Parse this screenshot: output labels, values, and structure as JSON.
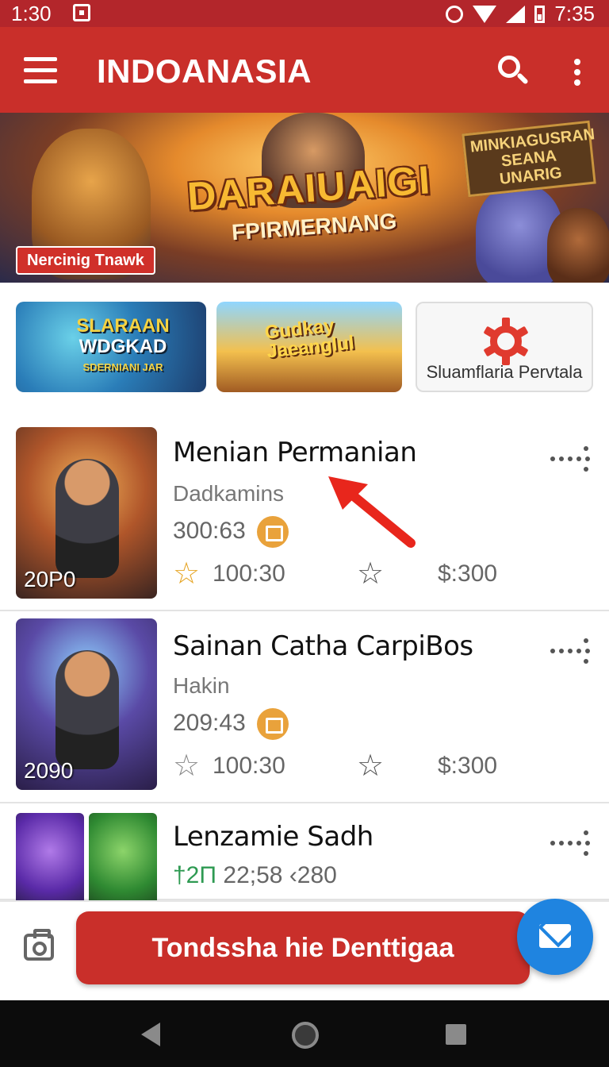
{
  "status_bar": {
    "time_left": "1:30",
    "time_right": "7:35"
  },
  "app_bar": {
    "title": "INDOANASIA"
  },
  "hero": {
    "title": "DARAIUAIGI",
    "subtitle": "FPIRMERNANG",
    "tag": "MINKIAGUSRAN SEANA UNARIG",
    "badge": "Nercinig Tnawk"
  },
  "categories": [
    {
      "line1": "SLARAAN",
      "line2": "WDGKAD",
      "line3": "SDERNIANI JAR"
    },
    {
      "line1": "Gudkay",
      "line2": "Jaeanglul"
    },
    {
      "label": "Sluamflaria Pervtala",
      "icon": "gear-icon"
    }
  ],
  "list": [
    {
      "title": "Menian Permanian",
      "subtitle": "Dadkamins",
      "time": "300:63",
      "rating": "100:30",
      "price": "$:300",
      "year": "20P0"
    },
    {
      "title": "Sainan Catha CarpiBos",
      "subtitle": "Hakin",
      "time": "209:43",
      "rating": "100:30",
      "price": "$:300",
      "year": "2090"
    },
    {
      "title": "Lenzamie Sadh",
      "meta_prefix": "†2Π",
      "meta_time": "22;58",
      "meta_extra": "‹280"
    }
  ],
  "bottom_bar": {
    "cta_label": "Tondssha hie Denttigaa"
  },
  "colors": {
    "primary": "#c92f2a",
    "status": "#b3262b",
    "fab": "#1f84e0",
    "arrow": "#e8261c",
    "star": "#e6a525"
  }
}
